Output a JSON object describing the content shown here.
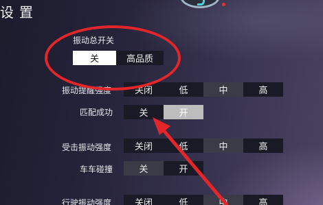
{
  "header": {
    "title": "设置"
  },
  "master": {
    "label": "振动总开关",
    "options": [
      "关",
      "高品质"
    ],
    "selected": "关"
  },
  "rows": [
    {
      "label": "振动提醒强度",
      "options": [
        "关闭",
        "低",
        "中",
        "高"
      ],
      "selected": "中"
    },
    {
      "label": "匹配成功",
      "options": [
        "关",
        "开"
      ],
      "selected": "开"
    },
    {
      "label": "受击振动强度",
      "options": [
        "关闭",
        "低",
        "中",
        "高"
      ],
      "selected": "中"
    },
    {
      "label": "车车碰撞",
      "options": [
        "关",
        "开"
      ],
      "selected": "关"
    },
    {
      "label": "行驶振动强度",
      "options": [
        "关闭",
        "低",
        "中",
        "高"
      ],
      "selected": "中"
    }
  ],
  "colors": {
    "annotation": "#e3262a",
    "selected_bg": "#3b3b48",
    "panel_bg": "#1a1a26"
  },
  "icons": [
    "emblem-icon",
    "notification-dot-icon"
  ]
}
